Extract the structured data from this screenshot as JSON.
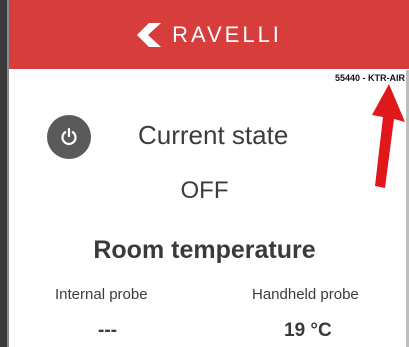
{
  "header": {
    "brand_name": "RAVELLI",
    "brand_icon": "ravelli-logo-icon",
    "background_color": "#d63d3b"
  },
  "device": {
    "id_label": "55440 - KTR-AIR"
  },
  "status": {
    "power_icon": "power-icon",
    "label": "Current state",
    "value": "OFF"
  },
  "room_temperature": {
    "title": "Room temperature",
    "probes": [
      {
        "label": "Internal probe",
        "value": "---"
      },
      {
        "label": "Handheld probe",
        "value": "19 °C"
      }
    ]
  },
  "annotation": {
    "arrow_icon": "red-arrow-icon",
    "arrow_color": "#e0181c"
  }
}
